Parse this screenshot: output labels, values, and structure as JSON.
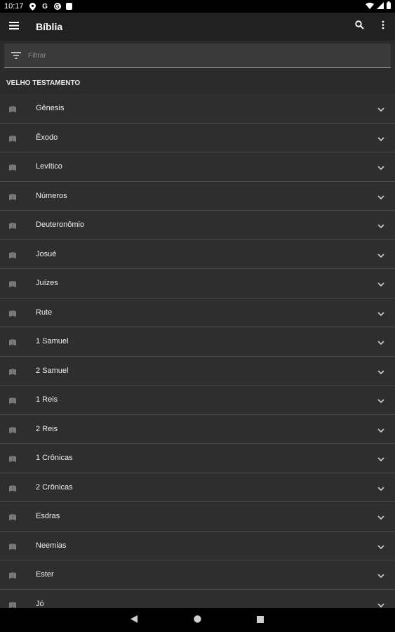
{
  "status_bar": {
    "time": "10:17",
    "notification_icons": [
      "location-icon",
      "google-icon",
      "google-circle-icon",
      "sd-card-icon"
    ],
    "system_icons": [
      "wifi-icon",
      "signal-icon",
      "battery-icon"
    ]
  },
  "app_bar": {
    "title": "Bíblia",
    "menu_icon": "hamburger-menu-icon",
    "search_icon": "search-icon",
    "overflow_icon": "more-vert-icon"
  },
  "filter": {
    "placeholder": "Filtrar",
    "value": "",
    "icon": "filter-icon"
  },
  "section": {
    "title": "VELHO TESTAMENTO"
  },
  "books": [
    {
      "label": "Gênesis"
    },
    {
      "label": "Êxodo"
    },
    {
      "label": "Levítico"
    },
    {
      "label": "Números"
    },
    {
      "label": "Deuteronômio"
    },
    {
      "label": "Josué"
    },
    {
      "label": "Juízes"
    },
    {
      "label": "Rute"
    },
    {
      "label": "1 Samuel"
    },
    {
      "label": "2 Samuel"
    },
    {
      "label": "1 Reis"
    },
    {
      "label": "2 Reis"
    },
    {
      "label": "1 Crônicas"
    },
    {
      "label": "2 Crônicas"
    },
    {
      "label": "Esdras"
    },
    {
      "label": "Neemias"
    },
    {
      "label": "Ester"
    },
    {
      "label": "Jó"
    }
  ],
  "nav_bar": {
    "back_icon": "back-icon",
    "home_icon": "home-icon",
    "recents_icon": "recents-icon"
  },
  "colors": {
    "background": "#2b2b2b",
    "app_bar": "#212121",
    "row": "#2e2e2e",
    "divider": "#4a4a4a",
    "text": "#ffffff"
  }
}
